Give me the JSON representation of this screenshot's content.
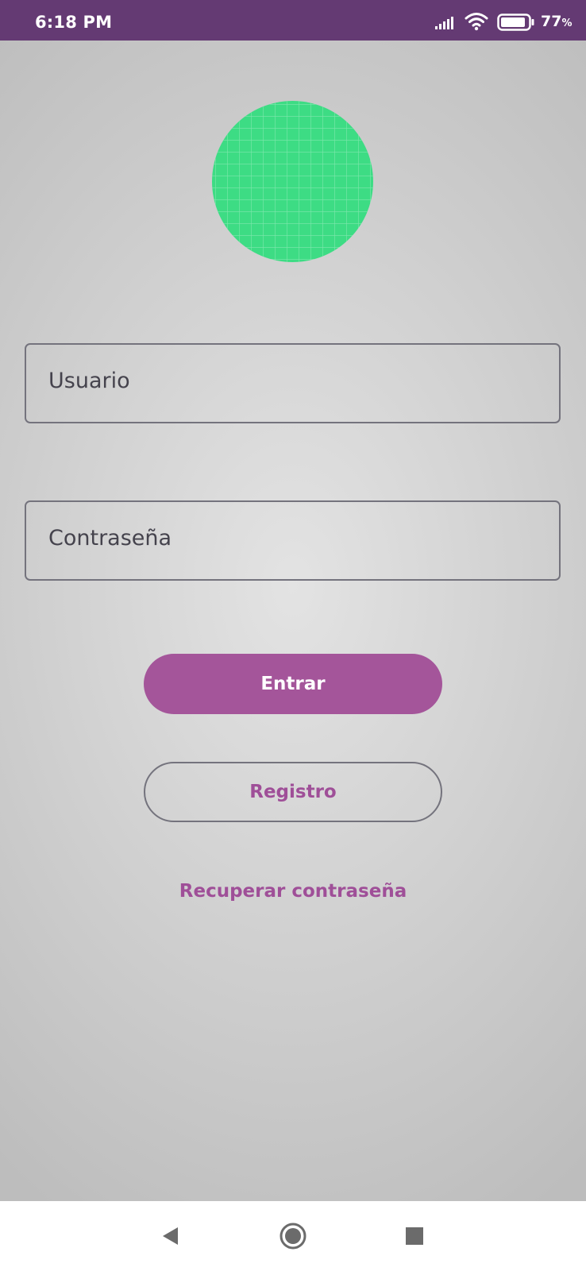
{
  "status_bar": {
    "time": "6:18 PM",
    "battery_percent": "77",
    "battery_unit": "%",
    "icons": [
      "signal-icon",
      "wifi-icon",
      "battery-icon"
    ],
    "background_color": "#643a73"
  },
  "logo": {
    "icon": "grid-circle-logo",
    "color": "#3ddc84"
  },
  "login_form": {
    "username_placeholder": "Usuario",
    "password_placeholder": "Contraseña"
  },
  "actions": {
    "login_label": "Entrar",
    "register_label": "Registro",
    "recover_password_label": "Recuperar contraseña"
  },
  "nav_bar": {
    "icons": [
      "back-icon",
      "home-icon",
      "recents-icon"
    ]
  },
  "colors": {
    "accent": "#a4559a",
    "accent_text": "#9f4f98",
    "outline": "#74737d"
  }
}
